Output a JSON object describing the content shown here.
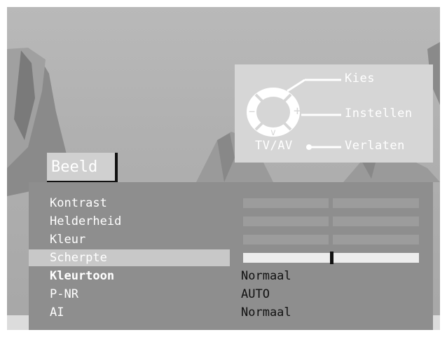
{
  "remote_hint": {
    "select_label": "Kies",
    "adjust_label": "Instellen",
    "exit_label": "Verlaten",
    "tvav_label": "TV/AV",
    "up_symbol": "^",
    "down_symbol": "v",
    "minus_symbol": "−",
    "plus_symbol": "+"
  },
  "menu": {
    "title": "Beeld",
    "items": [
      {
        "label": "Kontrast",
        "type": "bar"
      },
      {
        "label": "Helderheid",
        "type": "bar"
      },
      {
        "label": "Kleur",
        "type": "bar"
      },
      {
        "label": "Scherpte",
        "type": "bar",
        "selected": true,
        "level": 0.5
      },
      {
        "label": "Kleurtoon",
        "type": "value",
        "value": "Normaal"
      },
      {
        "label": "P-NR",
        "type": "value",
        "value": "AUTO"
      },
      {
        "label": "AI",
        "type": "value",
        "value": "Normaal"
      }
    ]
  },
  "colors": {
    "osd_panel": "#8e8e8e",
    "highlight": "#c8c8c8",
    "text": "#ffffff",
    "value_text": "#111111"
  }
}
